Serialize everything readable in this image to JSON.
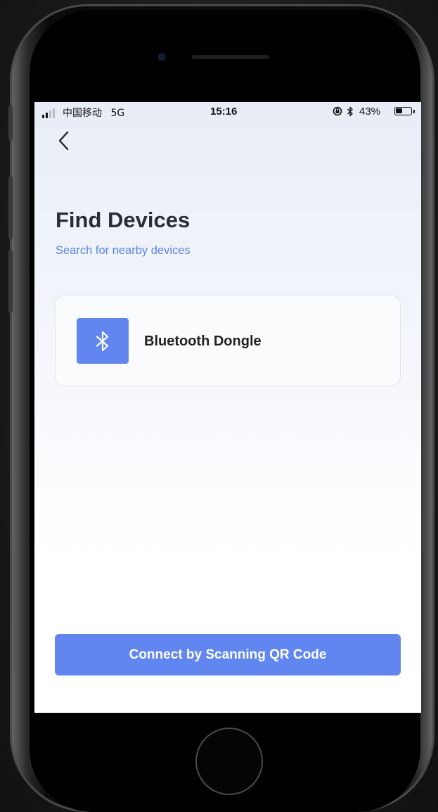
{
  "status_bar": {
    "carrier": "中国移动",
    "network": "5G",
    "time": "15:16",
    "battery_percent_label": "43%",
    "battery_level": 0.43,
    "icons": [
      "signal-icon",
      "orientation-lock-icon",
      "bluetooth-icon",
      "battery-icon"
    ]
  },
  "header": {
    "back_icon": "chevron-left-icon"
  },
  "page": {
    "title": "Find Devices",
    "subtitle": "Search for nearby devices"
  },
  "devices": [
    {
      "label": "Bluetooth Dongle",
      "icon": "bluetooth-icon"
    }
  ],
  "actions": {
    "qr_button_label": "Connect by Scanning QR Code"
  },
  "colors": {
    "accent": "#6286f0",
    "subtitle": "#5a82e6",
    "title": "#2a2d33",
    "card_border": "#dde3ee"
  }
}
